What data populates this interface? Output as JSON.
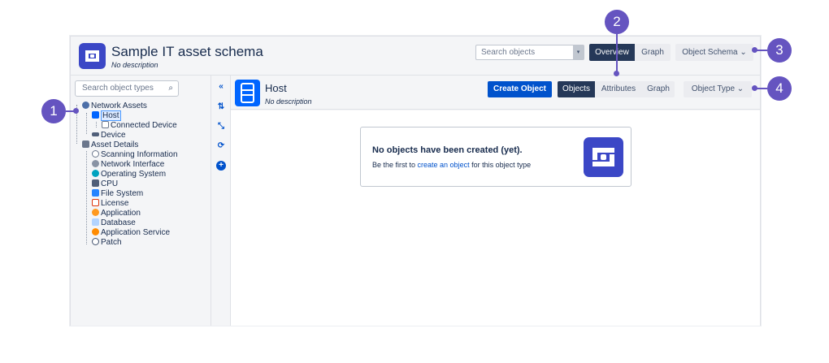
{
  "header": {
    "title": "Sample IT asset schema",
    "description": "No description",
    "search_placeholder": "Search objects",
    "search_dropdown": "▾",
    "overview_label": "Overview",
    "graph_label": "Graph",
    "object_schema_label": "Object Schema ⌄"
  },
  "sidebar": {
    "search_placeholder": "Search object types",
    "search_icon": "⌕",
    "items": [
      {
        "label": "Network Assets",
        "icon": "network-icon"
      },
      {
        "label": "Host",
        "icon": "host-icon"
      },
      {
        "label": "Connected Device",
        "icon": "connected-device-icon"
      },
      {
        "label": "Device",
        "icon": "device-icon"
      },
      {
        "label": "Asset Details",
        "icon": "asset-details-icon"
      },
      {
        "label": "Scanning Information",
        "icon": "scanning-icon"
      },
      {
        "label": "Network Interface",
        "icon": "network-interface-icon"
      },
      {
        "label": "Operating System",
        "icon": "os-icon"
      },
      {
        "label": "CPU",
        "icon": "cpu-icon"
      },
      {
        "label": "File System",
        "icon": "folder-icon"
      },
      {
        "label": "License",
        "icon": "license-icon"
      },
      {
        "label": "Application",
        "icon": "application-icon"
      },
      {
        "label": "Database",
        "icon": "database-icon"
      },
      {
        "label": "Application Service",
        "icon": "application-service-icon"
      },
      {
        "label": "Patch",
        "icon": "patch-icon"
      }
    ]
  },
  "toolbar": {
    "collapse": "«",
    "tree": "⇅",
    "expand": "⤡",
    "refresh": "⟳",
    "add": "+"
  },
  "main": {
    "title": "Host",
    "description": "No description",
    "create_label": "Create Object",
    "objects_label": "Objects",
    "attributes_label": "Attributes",
    "graph_label": "Graph",
    "object_type_label": "Object Type ⌄",
    "empty_title": "No objects have been created (yet).",
    "empty_prefix": "Be the first to ",
    "empty_link": "create an object",
    "empty_suffix": " for this object type"
  },
  "callouts": [
    "1",
    "2",
    "3",
    "4"
  ],
  "colors": {
    "accent": "#0052cc",
    "dark_button": "#253858",
    "callout": "#6554c0",
    "logo": "#3b47c6"
  }
}
